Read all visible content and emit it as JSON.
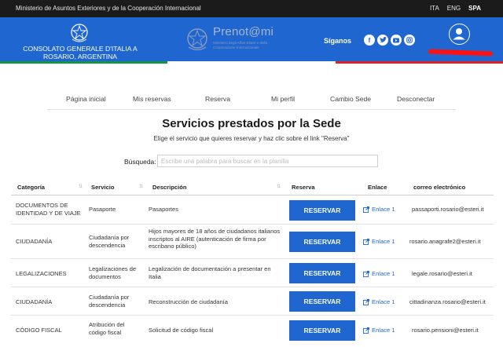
{
  "topbar": {
    "ministry": "Ministerio de Asuntos Exteriores y de la Cooperación Internacional",
    "languages": [
      "ITA",
      "ENG",
      "SPA"
    ],
    "active_language": "SPA"
  },
  "header": {
    "consulate_name": "Consolato Generale d'Italia a Rosario, Argentina",
    "app_logo": "Prenot@mi",
    "app_logo_sub": "Ministero degli Affari Esteri e della Cooperazione Internazionale",
    "follow_label": "Síganos",
    "social_icons": [
      "facebook-icon",
      "twitter-icon",
      "youtube-icon",
      "instagram-icon"
    ],
    "brand_color": "#1f66d1"
  },
  "nav": {
    "items": [
      "Página inicial",
      "Mis reservas",
      "Reserva",
      "Mi perfil",
      "Cambio Sede",
      "Desconectar"
    ]
  },
  "page": {
    "title": "Servicios prestados por la Sede",
    "subtitle": "Elige el servicio que quieres reservar y haz clic sobre el link \"Reserva\"",
    "search_label": "Búsqueda:",
    "search_placeholder": "Escribe una palabra para buscar en la planilla"
  },
  "table": {
    "headers": [
      "Categoría",
      "Servicio",
      "Descripción",
      "Reserva",
      "Enlace",
      "correo electrónico"
    ],
    "rows": [
      {
        "categoria": "DOCUMENTOS DE IDENTIDAD Y DE VIAJE",
        "servicio": "Pasaporte",
        "descripcion": "Pasaportes",
        "reserva": "RESERVAR",
        "enlace": "Enlace 1",
        "correo": "passaporti.rosario@esteri.it"
      },
      {
        "categoria": "CIUDADANÍA",
        "servicio": "Ciudadanía por descendencia",
        "descripcion": "Hijos mayores de 18 años de ciudadanos italianos inscriptos al AIRE (autenticación de firma por escribano público)",
        "reserva": "RESERVAR",
        "enlace": "Enlace 1",
        "correo": "rosario.anagrafe2@esteri.it"
      },
      {
        "categoria": "LEGALIZACIONES",
        "servicio": "Legalizaciones de documentos",
        "descripcion": "Legalización de documentación a presentar en Italia",
        "reserva": "RESERVAR",
        "enlace": "Enlace 1",
        "correo": "legale.rosario@esteri.it"
      },
      {
        "categoria": "CIUDADANÍA",
        "servicio": "Ciudadanía por descendencia",
        "descripcion": "Reconstrucción de ciudadanía",
        "reserva": "RESERVAR",
        "enlace": "Enlace 1",
        "correo": "cittadinanza.rosario@esteri.it"
      },
      {
        "categoria": "CÓDIGO FISCAL",
        "servicio": "Atribución del código fiscal",
        "descripcion": "Solicitud de código fiscal",
        "reserva": "RESERVAR",
        "enlace": "Enlace 1",
        "correo": "rosario.pensioni@esteri.it"
      }
    ]
  }
}
